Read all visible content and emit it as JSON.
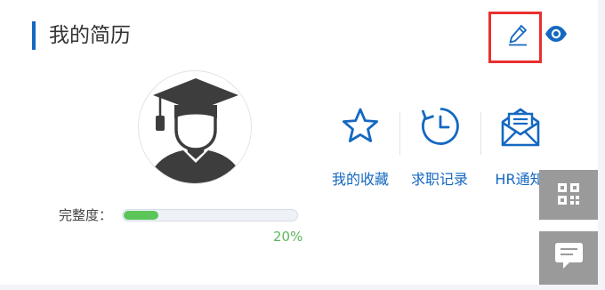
{
  "header": {
    "title": "我的简历",
    "edit_icon": "pencil-icon",
    "view_icon": "eye-icon"
  },
  "profile": {
    "avatar_icon": "graduate-avatar-icon",
    "completeness_label": "完整度：",
    "completeness_value": "20%",
    "completeness_fraction": 0.2
  },
  "nav": [
    {
      "label": "我的收藏",
      "icon": "star-icon"
    },
    {
      "label": "求职记录",
      "icon": "history-icon"
    },
    {
      "label": "HR通知",
      "icon": "envelope-icon"
    }
  ],
  "floating": [
    {
      "icon": "qr-code-icon"
    },
    {
      "icon": "chat-icon"
    }
  ],
  "colors": {
    "accent": "#1568c1",
    "highlight": "#e8302f",
    "progress": "#5cc55a",
    "float_bg": "#9a9a9a"
  }
}
